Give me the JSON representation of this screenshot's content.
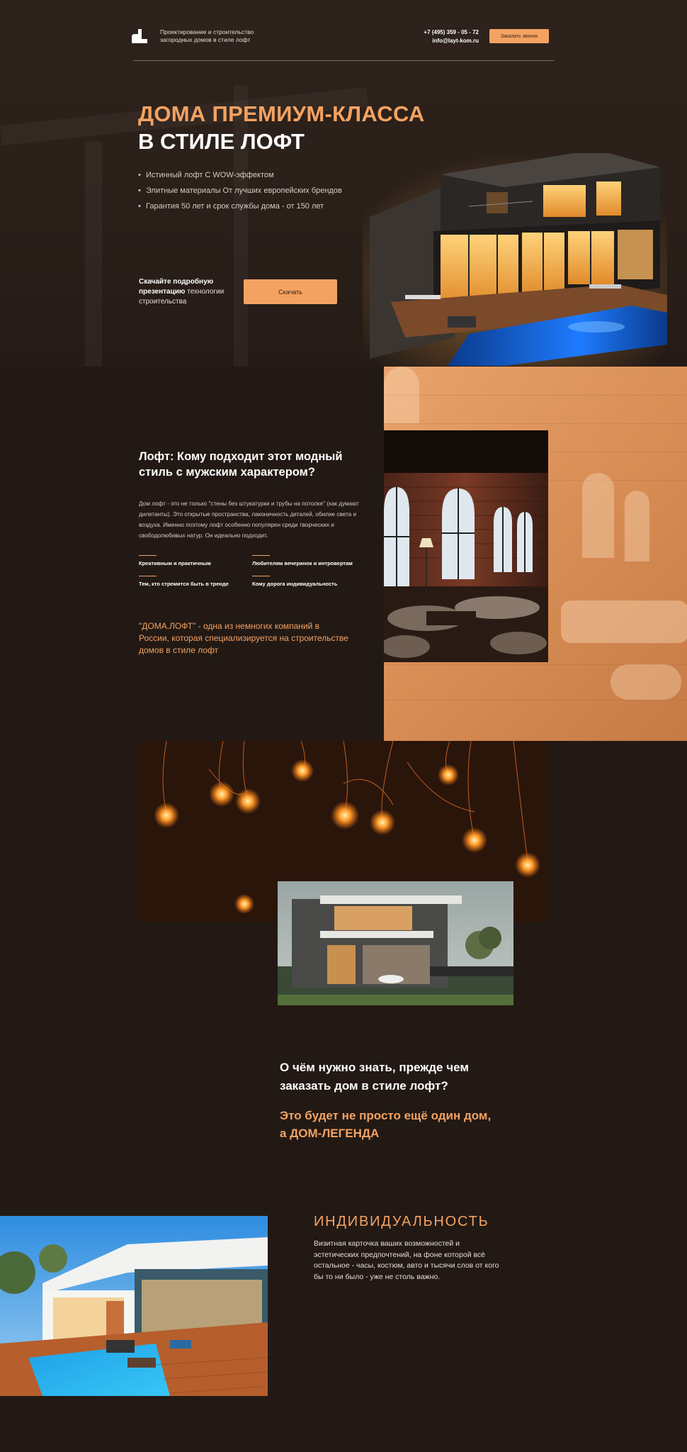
{
  "header": {
    "brand_tagline": "Проектирование и строительство загородных домов в стиле лофт",
    "phone": "+7 (495) 359 - 05 - 72",
    "email": "info@layt-kom.ru",
    "call_button": "Заказать звонок"
  },
  "hero": {
    "title_line1": "ДОМА ПРЕМИУМ-КЛАССА",
    "title_line2": "В СТИЛЕ ЛОФТ",
    "bullets": [
      "Истинный лофт С WOW-эффектом",
      "Элитные материалы От лучших европейских брендов",
      "Гарантия 50 лет и срок службы дома - от 150 лет"
    ],
    "download_bold": "Скачайте подробную презентацию",
    "download_rest": "технологии строительства",
    "download_button": "Скачать"
  },
  "loft": {
    "title": "Лофт: Кому подходит этот модный стиль с мужским характером?",
    "paragraph": "Дом лофт - это не только \"стены без штукатурки и трубы на потолке\" (как думают дилетанты). Это открытые пространства, лаконичность деталей, обилие света и воздуха. Именно поэтому лофт особенно популярен среди творческих и свободолюбивых натур. Он идеально подходит.",
    "tags": [
      "Креативным и практичным",
      "Любителям вечеринок и интровертам",
      "Тем, кто стремится быть в тренде",
      "Кому дорога индивидуальность"
    ],
    "quote": "\"ДОМА.ЛОФТ\" - одна из немногих компаний в России, которая специализируется на строительстве домов в стиле лофт"
  },
  "faq": {
    "question": "О чём нужно знать, прежде чем заказать дом в стиле лофт?",
    "answer": "Это будет не просто ещё один дом, а ДОМ-ЛЕГЕНДА"
  },
  "individuality": {
    "title": "ИНДИВИДУАЛЬНОСТЬ",
    "text": "Визитная карточка ваших возможностей и эстетических предпочтений, на фоне которой всё остальное - часы, костюм, авто и тысячи слов от кого бы то ни было - уже не столь важно."
  },
  "colors": {
    "background": "#221915",
    "accent": "#f4a261",
    "text": "#ffffff"
  }
}
